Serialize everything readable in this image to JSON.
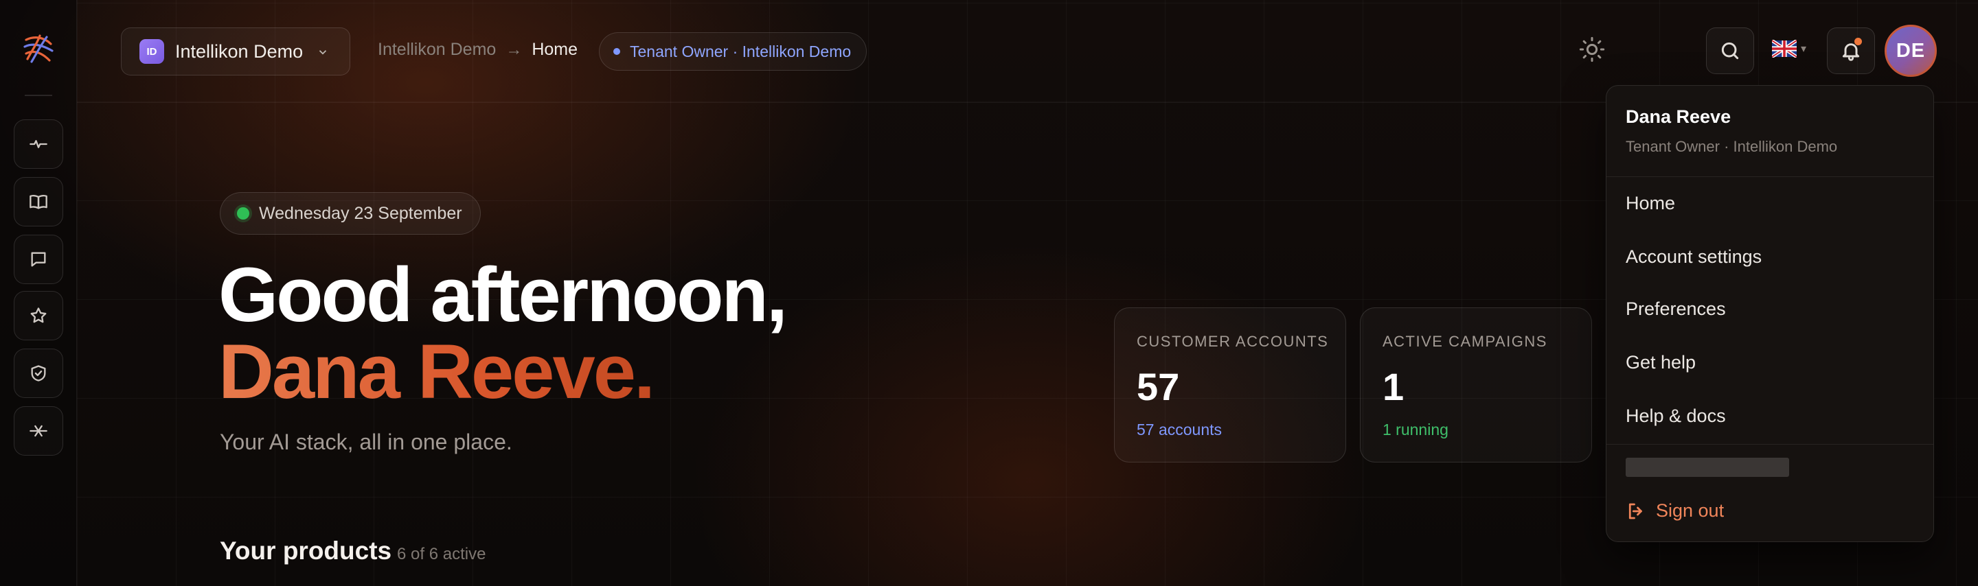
{
  "header": {
    "tenant": {
      "initials": "ID",
      "name": "Intellikon Demo"
    },
    "breadcrumb": {
      "parent": "Intellikon Demo",
      "separator": "→",
      "current": "Home"
    },
    "role_pill": "Tenant Owner · Intellikon Demo",
    "avatar_initials": "DE"
  },
  "sidebar": {
    "items": [
      {
        "icon": "activity-icon"
      },
      {
        "icon": "book-icon"
      },
      {
        "icon": "chat-icon"
      },
      {
        "icon": "star-icon"
      },
      {
        "icon": "shield-check-icon"
      },
      {
        "icon": "connector-icon"
      }
    ]
  },
  "hero": {
    "date": "Wednesday 23 September",
    "greeting": "Good afternoon,",
    "name": "Dana Reeve.",
    "tagline": "Your AI stack, all in one place."
  },
  "stats": [
    {
      "label": "CUSTOMER ACCOUNTS",
      "value": "57",
      "sub": "57 accounts",
      "sub_color": "#7f98ff"
    },
    {
      "label": "ACTIVE CAMPAIGNS",
      "value": "1",
      "sub": "1 running",
      "sub_color": "#3fbf6a"
    }
  ],
  "products": {
    "title": "Your products",
    "count": "6 of 6 active"
  },
  "user_menu": {
    "name": "Dana Reeve",
    "role": "Tenant Owner · Intellikon Demo",
    "items": [
      "Home",
      "Account settings",
      "Preferences",
      "Get help",
      "Help & docs"
    ],
    "sign_out": "Sign out"
  },
  "colors": {
    "accent": "#e2643a",
    "link": "#7f98ff",
    "success": "#3fbf6a"
  }
}
